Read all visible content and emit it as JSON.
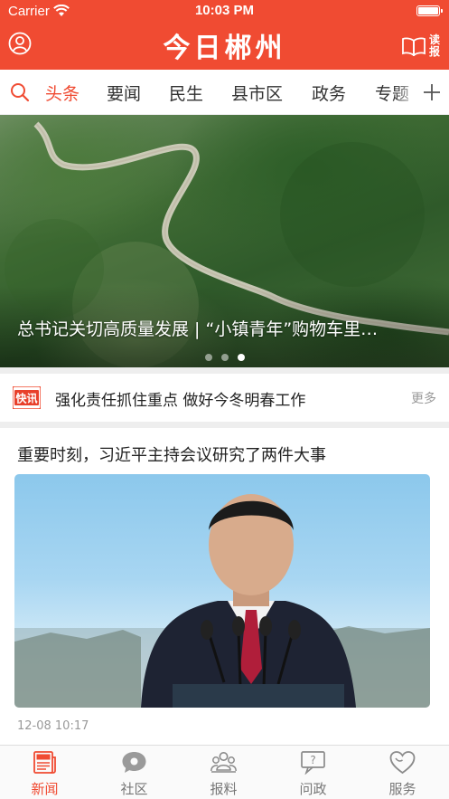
{
  "status_bar": {
    "carrier": "Carrier",
    "time": "10:03 PM"
  },
  "header": {
    "title": "今日郴州",
    "read_label": "读报"
  },
  "tabs": [
    {
      "label": "头条",
      "active": true
    },
    {
      "label": "要闻",
      "active": false
    },
    {
      "label": "民生",
      "active": false
    },
    {
      "label": "县市区",
      "active": false
    },
    {
      "label": "政务",
      "active": false
    },
    {
      "label": "专题",
      "active": false
    }
  ],
  "banner": {
    "caption": "总书记关切高质量发展 | “小镇青年”购物车里…",
    "slide_count": 3,
    "active_slide": 3
  },
  "flash": {
    "badge": "快讯",
    "headline": "强化责任抓住重点  做好今冬明春工作",
    "more": "更多"
  },
  "article": {
    "title": "重要时刻，习近平主持会议研究了两件大事",
    "time": "12-08  10:17"
  },
  "bottom_nav": [
    {
      "label": "新闻",
      "icon": "newspaper-icon",
      "active": true
    },
    {
      "label": "社区",
      "icon": "chat-bubble-icon",
      "active": false
    },
    {
      "label": "报料",
      "icon": "people-icon",
      "active": false
    },
    {
      "label": "问政",
      "icon": "question-board-icon",
      "active": false
    },
    {
      "label": "服务",
      "icon": "heart-icon",
      "active": false
    }
  ],
  "colors": {
    "brand_red": "#f04b32",
    "text_dark": "#222222",
    "text_muted": "#999999",
    "divider": "#eeeeee"
  }
}
